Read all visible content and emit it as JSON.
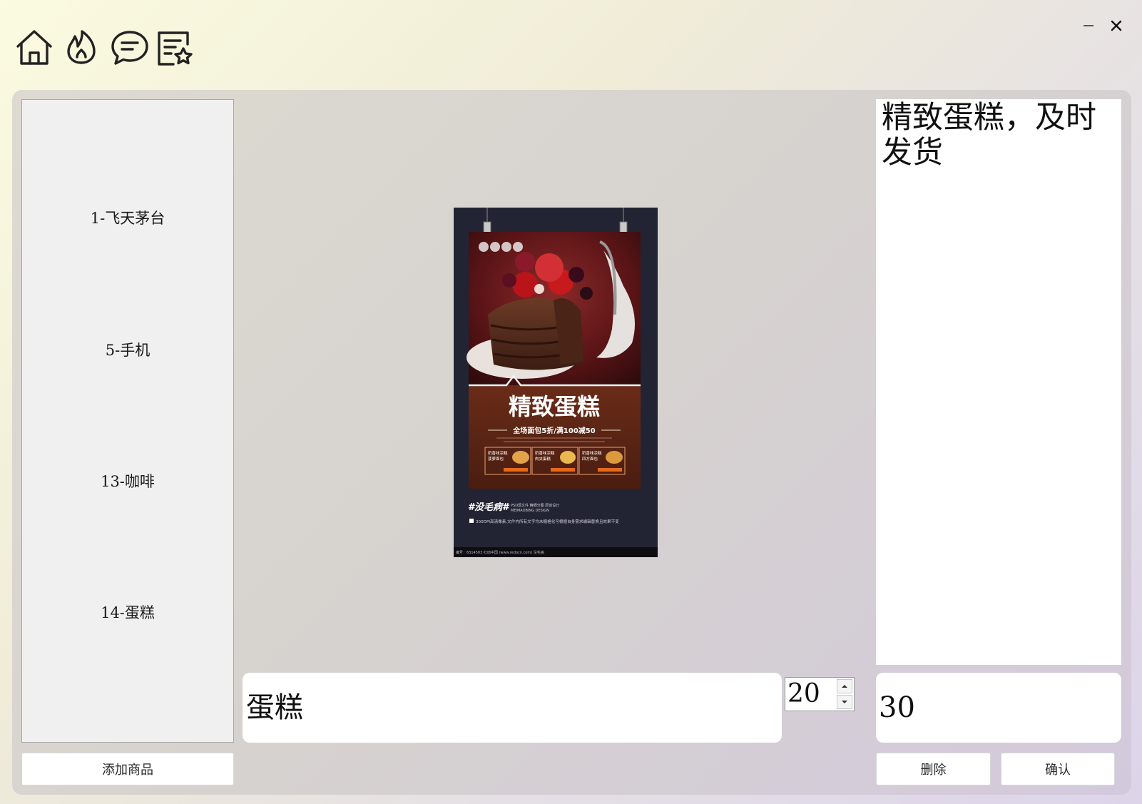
{
  "toolbar": {
    "icons": [
      "home-icon",
      "flame-icon",
      "chat-icon",
      "favorites-list-icon"
    ]
  },
  "window": {
    "minimize": "–",
    "close": "×"
  },
  "products": {
    "items": [
      {
        "label": "1-飞天茅台"
      },
      {
        "label": "5-手机"
      },
      {
        "label": "13-咖啡"
      },
      {
        "label": "14-蛋糕"
      }
    ],
    "add_button": "添加商品"
  },
  "poster": {
    "headline": "精致蛋糕",
    "subline": "全场面包5折/满100减50",
    "brand": "#没毛病#",
    "brand_sub1": "PSD源文件 精细分图 原创设计",
    "brand_sub2": "MEIMAOBING DESIGN",
    "note": "300DPI高清像素,文件内所有文字均未栅格化可根据自身需求编辑替换且效果不变",
    "footer": "编号：6314503   红动中国 (www.redocn.com)   没毛病",
    "coupons": [
      {
        "title": "奶香味凉糕",
        "sub": "菠萝面包"
      },
      {
        "title": "奶香味凉糕",
        "sub": "肉夹蛋糕"
      },
      {
        "title": "奶香味凉糕",
        "sub": "四方面包"
      }
    ]
  },
  "editor": {
    "description": "精致蛋糕，及时发货",
    "name": "蛋糕",
    "quantity": "20",
    "price": "30",
    "delete_button": "删除",
    "confirm_button": "确认"
  }
}
